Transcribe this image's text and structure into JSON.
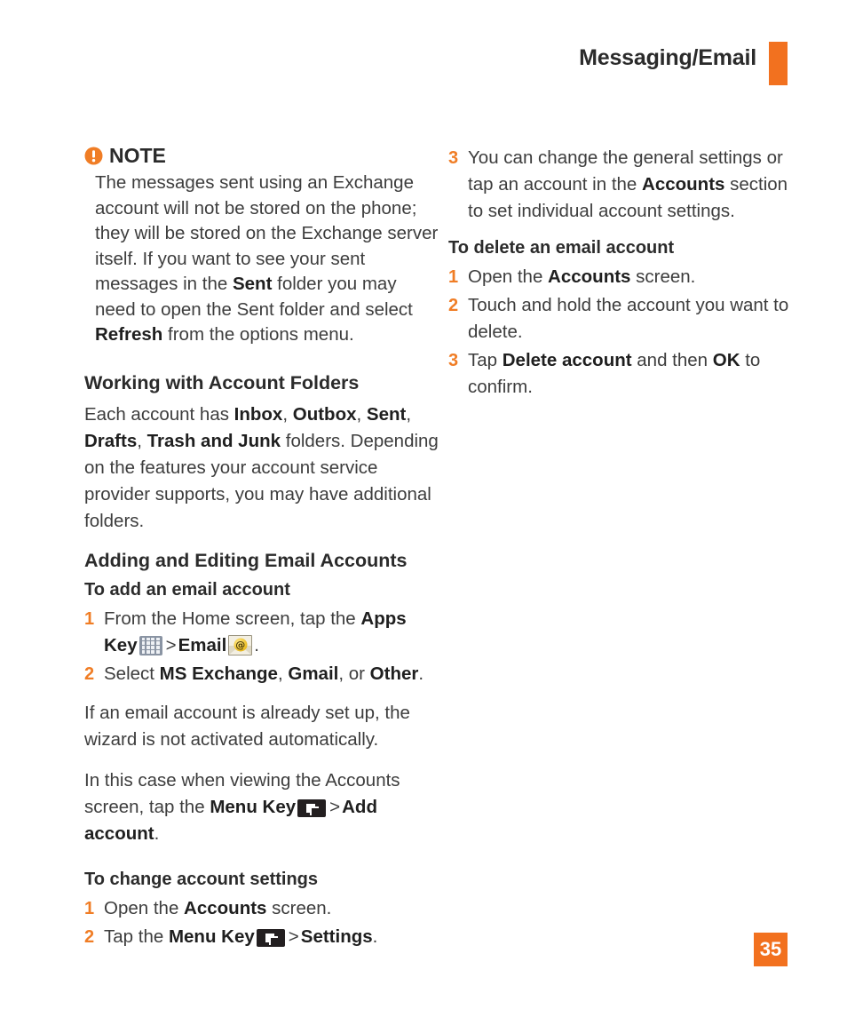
{
  "header": {
    "title": "Messaging/Email",
    "accent_color": "#f2711f"
  },
  "page_number": "35",
  "left_column": {
    "note": {
      "icon": "exclamation-circle-icon",
      "label": "NOTE",
      "body_parts": {
        "p1": "The messages sent using an Exchange account will not be stored on the phone; they will be stored on the Exchange server itself. If you want to see your sent messages in the ",
        "b1": "Sent",
        "p2": " folder you may need to open the Sent folder and select ",
        "b2": "Refresh",
        "p3": " from the options menu."
      }
    },
    "working_heading": "Working with Account Folders",
    "working_para": {
      "p1": "Each account has ",
      "b1": "Inbox",
      "p2": ", ",
      "b2": "Outbox",
      "p3": ", ",
      "b3": "Sent",
      "p4": ", ",
      "b4": "Drafts",
      "p5": ", ",
      "b5": "Trash and Junk",
      "p6": " folders. Depending on the features your account service provider supports, you may have additional folders."
    },
    "adding_heading": "Adding and Editing Email Accounts",
    "add_subheading": "To add an email account",
    "add_steps": [
      {
        "num": "1",
        "p1": "From the Home screen, tap the ",
        "b1": "Apps Key",
        "icon1": "apps-key-icon",
        "sep": ">",
        "b2": "Email",
        "icon2": "email-icon",
        "p2": "."
      },
      {
        "num": "2",
        "p1": "Select ",
        "b1": "MS Exchange",
        "p2": ", ",
        "b2": "Gmail",
        "p3": ", or ",
        "b3": "Other",
        "p4": "."
      }
    ],
    "wizard_para": "If an email account is already set up, the wizard is not activated automatically.",
    "in_this_case_para": {
      "p1": "In this case when viewing the Accounts screen, tap the ",
      "b1": "Menu Key",
      "icon": "menu-key-icon",
      "sep": ">",
      "b2": "Add account",
      "p2": "."
    },
    "change_subheading": "To change account settings",
    "change_steps": [
      {
        "num": "1",
        "p1": "Open the ",
        "b1": "Accounts",
        "p2": " screen."
      },
      {
        "num": "2",
        "p1": "Tap the ",
        "b1": "Menu Key",
        "icon": "menu-key-icon",
        "sep": ">",
        "b2": "Settings",
        "p2": "."
      }
    ]
  },
  "right_column": {
    "step3_general": {
      "num": "3",
      "p1": "You can change the general settings or tap an account in the ",
      "b1": "Accounts",
      "p2": " section to set individual account settings."
    },
    "delete_subheading": "To delete an email account",
    "delete_steps": [
      {
        "num": "1",
        "p1": "Open the ",
        "b1": "Accounts",
        "p2": " screen."
      },
      {
        "num": "2",
        "p1": "Touch and hold the account you want to delete.",
        "b1": "",
        "p2": ""
      },
      {
        "num": "3",
        "p1": "Tap ",
        "b1": "Delete account",
        "p2": " and then ",
        "b2": "OK",
        "p3": " to confirm."
      }
    ]
  }
}
